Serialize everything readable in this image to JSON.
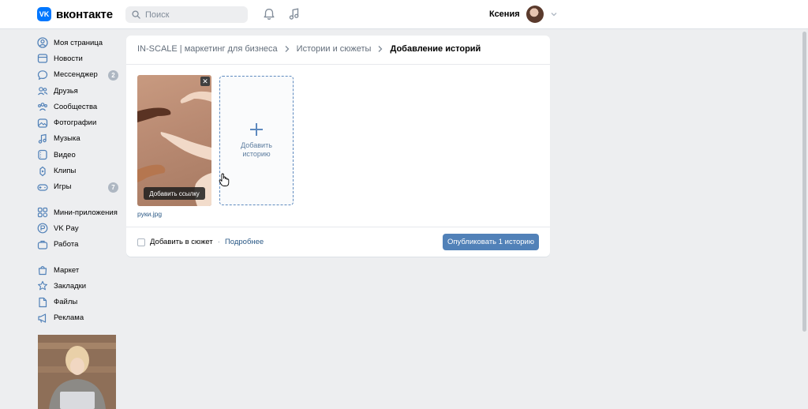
{
  "header": {
    "logo_text": "вконтакте",
    "logo_mark": "VK",
    "search_placeholder": "Поиск",
    "user_name": "Ксения"
  },
  "sidebar": {
    "items": [
      {
        "label": "Моя страница",
        "icon": "user-circle-icon"
      },
      {
        "label": "Новости",
        "icon": "newspaper-icon"
      },
      {
        "label": "Мессенджер",
        "icon": "message-icon",
        "badge": "2"
      },
      {
        "label": "Друзья",
        "icon": "friends-icon"
      },
      {
        "label": "Сообщества",
        "icon": "community-icon"
      },
      {
        "label": "Фотографии",
        "icon": "photo-icon"
      },
      {
        "label": "Музыка",
        "icon": "music-icon"
      },
      {
        "label": "Видео",
        "icon": "video-icon"
      },
      {
        "label": "Клипы",
        "icon": "clips-icon"
      },
      {
        "label": "Игры",
        "icon": "gamepad-icon",
        "badge": "7"
      }
    ],
    "items2": [
      {
        "label": "Мини-приложения",
        "icon": "apps-icon"
      },
      {
        "label": "VK Pay",
        "icon": "vkpay-icon"
      },
      {
        "label": "Работа",
        "icon": "briefcase-icon"
      }
    ],
    "items3": [
      {
        "label": "Маркет",
        "icon": "bag-icon"
      },
      {
        "label": "Закладки",
        "icon": "star-icon"
      },
      {
        "label": "Файлы",
        "icon": "file-icon"
      },
      {
        "label": "Реклама",
        "icon": "megaphone-icon"
      }
    ]
  },
  "breadcrumb": {
    "items": [
      "IN-SCALE | маркетинг для бизнеса",
      "Истории и сюжеты",
      "Добавление историй"
    ]
  },
  "story": {
    "add_link_label": "Добавить ссылку",
    "file_name": "руки.jpg",
    "close_label": "✕"
  },
  "add_story": {
    "label": "Добавить историю"
  },
  "footer": {
    "checkbox_label": "Добавить в сюжет",
    "separator": "·",
    "more_link": "Подробнее",
    "publish_label": "Опубликовать 1 историю"
  },
  "colors": {
    "accent": "#5181b8",
    "link": "#2a5885",
    "background": "#edeef0"
  }
}
